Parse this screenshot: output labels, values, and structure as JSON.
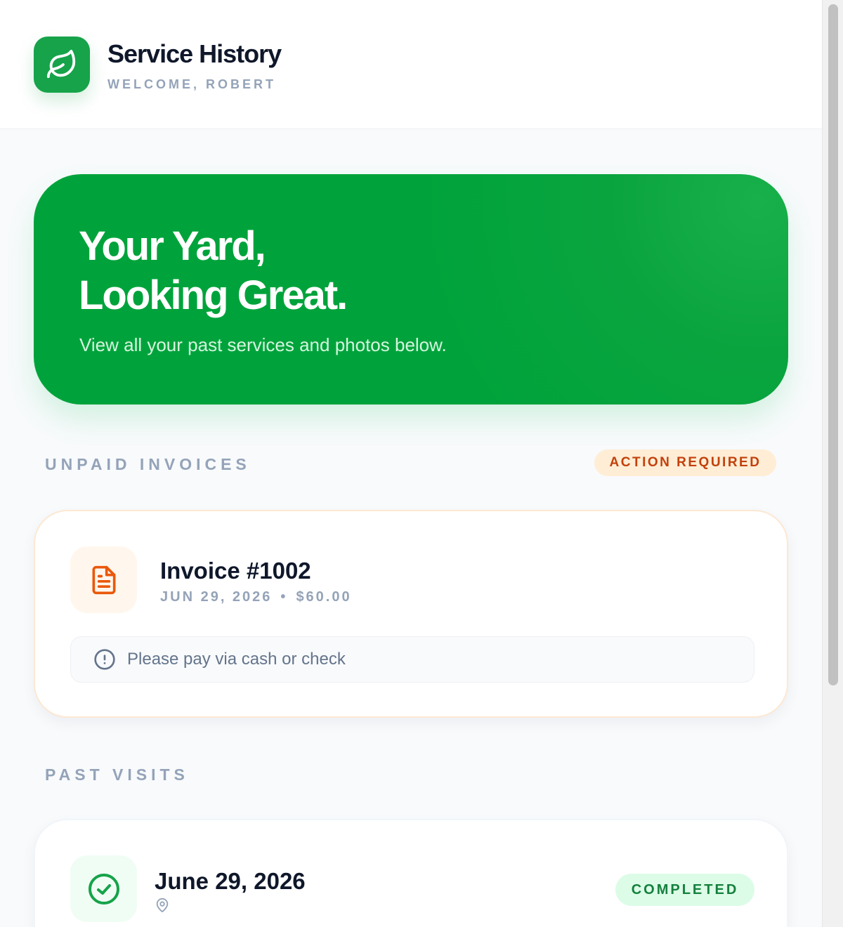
{
  "header": {
    "title": "Service History",
    "subtitle": "WELCOME, ROBERT",
    "logo_icon": "leaf-icon",
    "accent_color": "#16a34a"
  },
  "hero": {
    "title_line1": "Your Yard,",
    "title_line2": "Looking Great.",
    "subtitle": "View all your past services and photos below."
  },
  "unpaid": {
    "section_label": "UNPAID INVOICES",
    "badge": "ACTION REQUIRED",
    "invoices": [
      {
        "title": "Invoice #1002",
        "date": "JUN 29, 2026",
        "separator": "•",
        "amount": "$60.00",
        "icon": "document-icon",
        "note": "Please pay via cash or check",
        "note_icon": "info-circle-icon"
      }
    ]
  },
  "past": {
    "section_label": "PAST VISITS",
    "visits": [
      {
        "date": "June 29, 2026",
        "status": "COMPLETED",
        "icon": "check-circle-icon",
        "location_icon": "map-pin-icon"
      }
    ]
  }
}
